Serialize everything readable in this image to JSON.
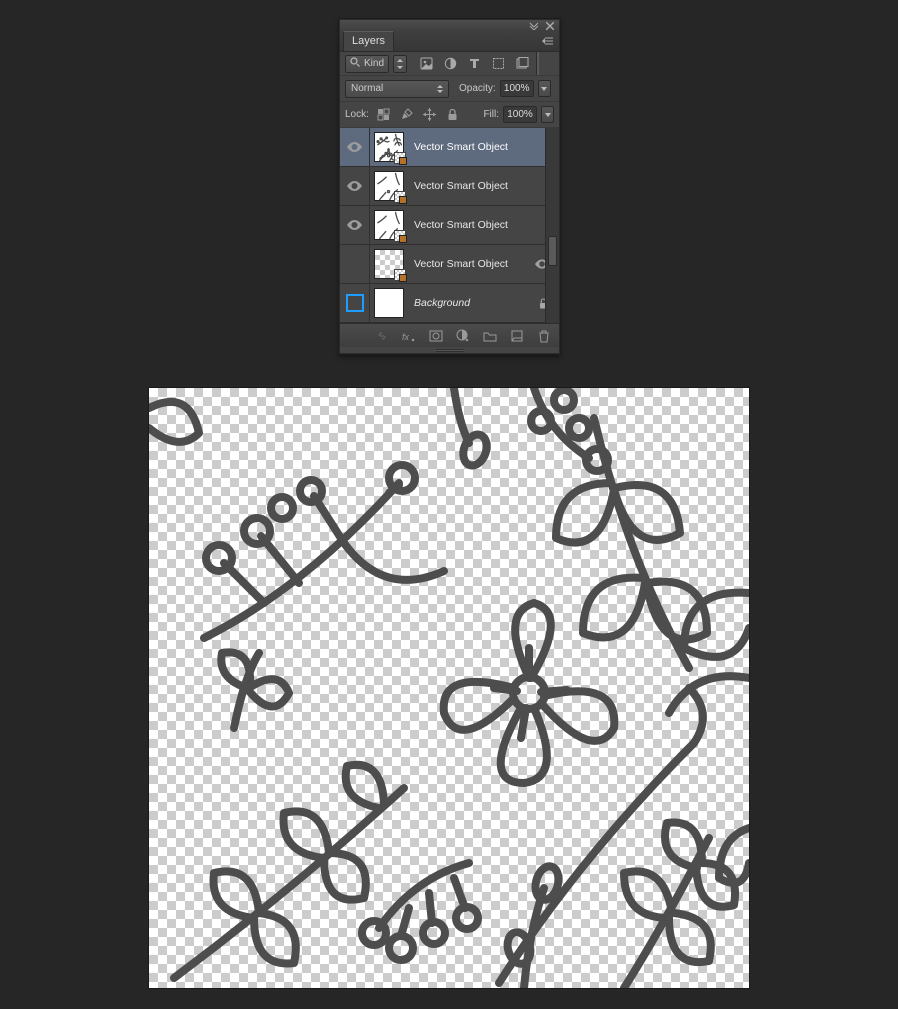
{
  "panel": {
    "title": "Layers",
    "kind": {
      "search_label": "Kind"
    },
    "blend": {
      "mode": "Normal",
      "opacity_label": "Opacity:",
      "opacity_value": "100%"
    },
    "lock": {
      "label": "Lock:",
      "fill_label": "Fill:",
      "fill_value": "100%"
    },
    "layers": [
      {
        "name": "Vector Smart Object",
        "visible": true,
        "selected": true,
        "thumb": "floral",
        "smart": true
      },
      {
        "name": "Vector Smart Object",
        "visible": true,
        "selected": false,
        "thumb": "floral",
        "smart": true
      },
      {
        "name": "Vector Smart Object",
        "visible": true,
        "selected": false,
        "thumb": "floral",
        "smart": true
      },
      {
        "name": "Vector Smart Object",
        "visible": false,
        "selected": false,
        "thumb": "checker",
        "smart": true,
        "has_extra_eye": true
      },
      {
        "name": "Background",
        "visible": "frame",
        "selected": false,
        "thumb": "white",
        "locked": true,
        "italic": true
      }
    ]
  }
}
